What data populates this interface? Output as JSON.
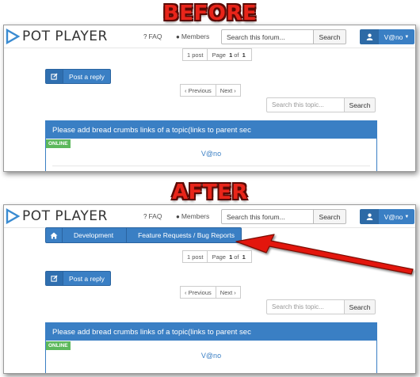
{
  "labels": {
    "before": "BEFORE",
    "after": "AFTER"
  },
  "header": {
    "logo": "POT PLAYER",
    "faq": "FAQ",
    "members": "Members",
    "search_placeholder": "Search this forum...",
    "search_button": "Search",
    "username": "V@no"
  },
  "breadcrumbs": {
    "items": [
      "Development",
      "Feature Requests / Bug Reports"
    ]
  },
  "pagination": {
    "posts": "1 post",
    "page_prefix": "Page",
    "current": "1",
    "of": "of",
    "total": "1"
  },
  "actions": {
    "reply": "Post a reply",
    "previous": "Previous",
    "next": "Next"
  },
  "topic_search": {
    "placeholder": "Search this topic...",
    "button": "Search"
  },
  "post": {
    "title": "Please add bread crumbs links of a topic(links to parent sec",
    "status": "ONLINE",
    "author": "V@no"
  },
  "colors": {
    "accent": "#3a7fc4",
    "online": "#5cb85c",
    "headline": "#e8251a",
    "arrow": "#e3140d"
  }
}
